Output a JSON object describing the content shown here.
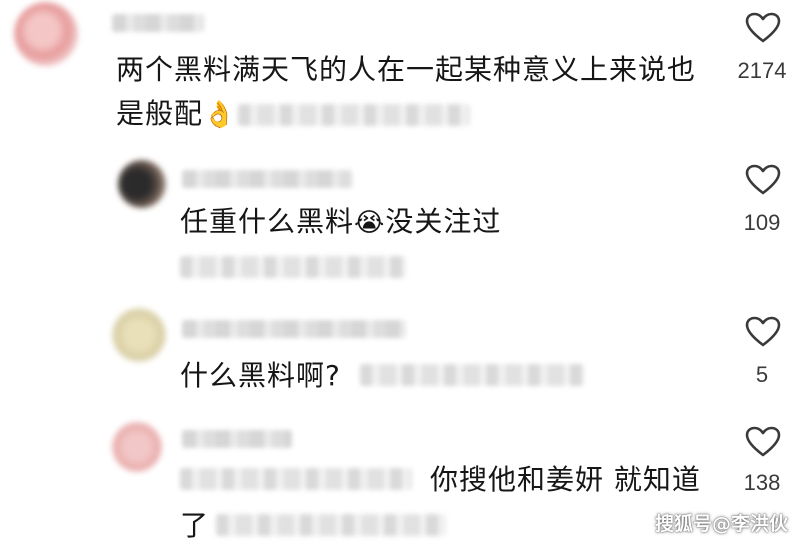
{
  "comments": [
    {
      "text": "两个黑料满天飞的人在一起某种意义上来说也是般配",
      "emoji": "👌",
      "likes": "2174"
    },
    {
      "text_before": "任重什么黑料",
      "emoji": "😭",
      "text_after": "没关注过",
      "likes": "109"
    },
    {
      "text": "什么黑料啊?",
      "likes": "5"
    },
    {
      "text_line1": "你搜他和姜妍 就知道",
      "text_line2": "了",
      "likes": "138"
    }
  ],
  "watermark": "搜狐号@李洪伙"
}
